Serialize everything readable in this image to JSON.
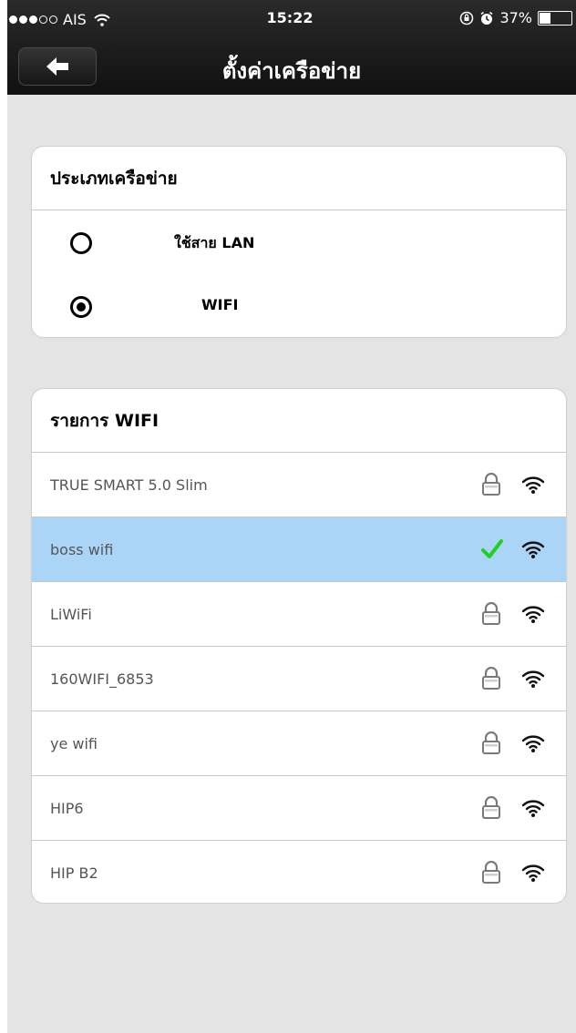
{
  "status_bar": {
    "carrier": "AIS",
    "time": "15:22",
    "battery": "37%",
    "battery_level": 0.37,
    "signal_bars_filled": 3,
    "signal_bars_total": 5
  },
  "nav": {
    "title": "ตั้งค่าเครือข่าย",
    "back_icon": "back-arrow-icon"
  },
  "network_type": {
    "header": "ประเภทเครือข่าย",
    "options": [
      {
        "label": "ใช้สาย LAN",
        "selected": false
      },
      {
        "label": "WIFI",
        "selected": true
      }
    ]
  },
  "wifi_list": {
    "header": "รายการ WIFI",
    "items": [
      {
        "name": "TRUE SMART 5.0 Slim",
        "status_icon": "lock-icon",
        "selected": false
      },
      {
        "name": "boss wifi",
        "status_icon": "checkmark-icon",
        "selected": true
      },
      {
        "name": "LiWiFi",
        "status_icon": "lock-icon",
        "selected": false
      },
      {
        "name": "160WIFI_6853",
        "status_icon": "lock-icon",
        "selected": false
      },
      {
        "name": "ye wifi",
        "status_icon": "lock-icon",
        "selected": false
      },
      {
        "name": "HIP6",
        "status_icon": "lock-icon",
        "selected": false
      },
      {
        "name": "HIP B2",
        "status_icon": "lock-icon",
        "selected": false
      }
    ]
  },
  "colors": {
    "background": "#e4e4e4",
    "navbar": "#1b1b1b",
    "selected_row": "#abd5f7",
    "check": "#1fd01f",
    "icon_gray": "#7a7a7a"
  }
}
